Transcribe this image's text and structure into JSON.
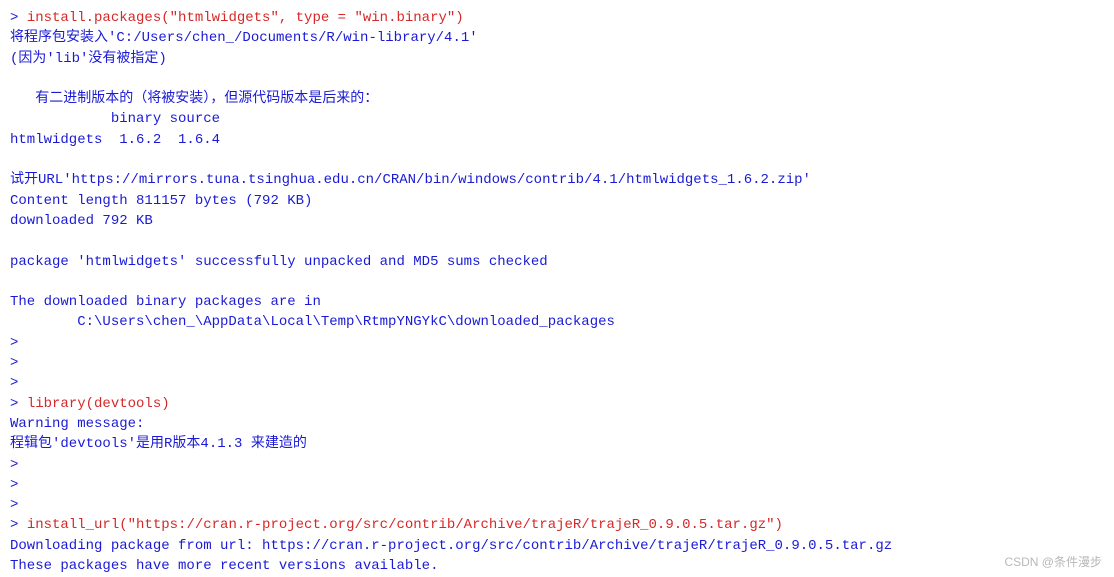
{
  "console": {
    "lines": [
      {
        "prompt": "> ",
        "cmd": "install.packages(\"htmlwidgets\", type = \"win.binary\")",
        "type": "input"
      },
      {
        "text": "将程序包安装入'C:/Users/chen_/Documents/R/win-library/4.1'",
        "type": "output"
      },
      {
        "text": "(因为'lib'没有被指定)",
        "type": "output"
      },
      {
        "text": "",
        "type": "output"
      },
      {
        "text": "   有二进制版本的（将被安装），但源代码版本是后来的：",
        "type": "output"
      },
      {
        "text": "            binary source",
        "type": "output"
      },
      {
        "text": "htmlwidgets  1.6.2  1.6.4",
        "type": "output"
      },
      {
        "text": "",
        "type": "output"
      },
      {
        "text": "试开URL'https://mirrors.tuna.tsinghua.edu.cn/CRAN/bin/windows/contrib/4.1/htmlwidgets_1.6.2.zip'",
        "type": "output"
      },
      {
        "text": "Content length 811157 bytes (792 KB)",
        "type": "output"
      },
      {
        "text": "downloaded 792 KB",
        "type": "output"
      },
      {
        "text": "",
        "type": "output"
      },
      {
        "text": "package 'htmlwidgets' successfully unpacked and MD5 sums checked",
        "type": "output"
      },
      {
        "text": "",
        "type": "output"
      },
      {
        "text": "The downloaded binary packages are in",
        "type": "output"
      },
      {
        "text": "        C:\\Users\\chen_\\AppData\\Local\\Temp\\RtmpYNGYkC\\downloaded_packages",
        "type": "output"
      },
      {
        "prompt": "> ",
        "cmd": "",
        "type": "input"
      },
      {
        "prompt": "> ",
        "cmd": "",
        "type": "input"
      },
      {
        "prompt": "> ",
        "cmd": "",
        "type": "input"
      },
      {
        "prompt": "> ",
        "cmd": "library(devtools)",
        "type": "input"
      },
      {
        "text": "Warning message:",
        "type": "output"
      },
      {
        "text": "程辑包'devtools'是用R版本4.1.3 来建造的 ",
        "type": "output"
      },
      {
        "prompt": "> ",
        "cmd": "",
        "type": "input"
      },
      {
        "prompt": "> ",
        "cmd": "",
        "type": "input"
      },
      {
        "prompt": "> ",
        "cmd": "",
        "type": "input"
      },
      {
        "prompt": "> ",
        "cmd": "install_url(\"https://cran.r-project.org/src/contrib/Archive/trajeR/trajeR_0.9.0.5.tar.gz\")",
        "type": "input"
      },
      {
        "text": "Downloading package from url: https://cran.r-project.org/src/contrib/Archive/trajeR/trajeR_0.9.0.5.tar.gz",
        "type": "output"
      },
      {
        "text": "These packages have more recent versions available.",
        "type": "output"
      }
    ]
  },
  "watermark": "CSDN @条件漫步"
}
